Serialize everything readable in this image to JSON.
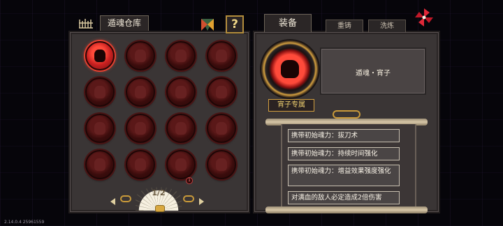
{
  "left_panel": {
    "title": "遁魂仓库",
    "help_label": "?",
    "page": "1/2",
    "slots": [
      {
        "state": "active"
      },
      {
        "state": "locked"
      },
      {
        "state": "locked"
      },
      {
        "state": "locked"
      },
      {
        "state": "locked"
      },
      {
        "state": "locked"
      },
      {
        "state": "locked"
      },
      {
        "state": "locked"
      },
      {
        "state": "locked"
      },
      {
        "state": "locked"
      },
      {
        "state": "locked"
      },
      {
        "state": "locked"
      },
      {
        "state": "locked"
      },
      {
        "state": "locked"
      },
      {
        "state": "locked"
      },
      {
        "state": "locked"
      }
    ],
    "badge": "1"
  },
  "right_panel": {
    "tab_main": "装备",
    "tab_recast": "重铸",
    "tab_wash": "洗炼",
    "soul_name": "遁魂・宵子",
    "exclusive_tag": "宵子专属",
    "attributes": [
      "携带初始魂力：拔刀术",
      "携带初始魂力：持续时间强化",
      "携带初始魂力：增益效果强度强化",
      "对满血的敌人必定造成2倍伤害"
    ]
  },
  "version": "2.14.0.4 25961559",
  "colors": {
    "panel": "#3a3535",
    "accent_gold": "#d4a040",
    "active_red": "#e04030"
  }
}
